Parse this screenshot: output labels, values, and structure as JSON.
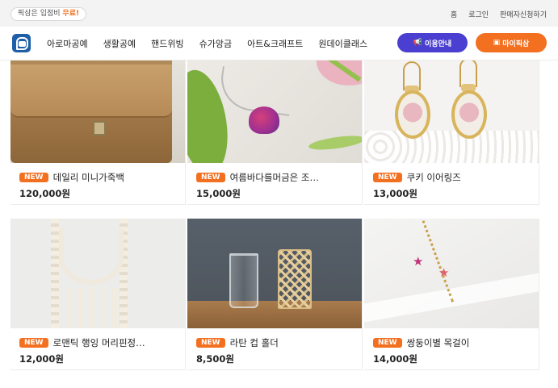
{
  "topbar": {
    "promo_prefix": "픽삼은 입점비",
    "promo_highlight": "무료!",
    "links": [
      "홈",
      "로그인",
      "판매자신청하기"
    ]
  },
  "nav": {
    "logo": "logo-icon",
    "menu": [
      "아로마공예",
      "생활공예",
      "핸드위빙",
      "슈가앙금",
      "아트&크래프트",
      "원데이클래스"
    ],
    "guide_button": "이용안내",
    "my_button": "마이픽삼",
    "colors": {
      "guide": "#4a3fd0",
      "accent": "#f37021"
    }
  },
  "badge": "NEW",
  "products": [
    {
      "title": "데일리 미니가죽백",
      "price": "120,000원"
    },
    {
      "title": "여름바다를머금은 조…",
      "price": "15,000원"
    },
    {
      "title": "쿠키 이어링즈",
      "price": "13,000원"
    },
    {
      "title": "로맨틱 행잉 머리핀정…",
      "price": "12,000원"
    },
    {
      "title": "라탄 컵 홀더",
      "price": "8,500원"
    },
    {
      "title": "쌍둥이별 목걸이",
      "price": "14,000원"
    }
  ]
}
